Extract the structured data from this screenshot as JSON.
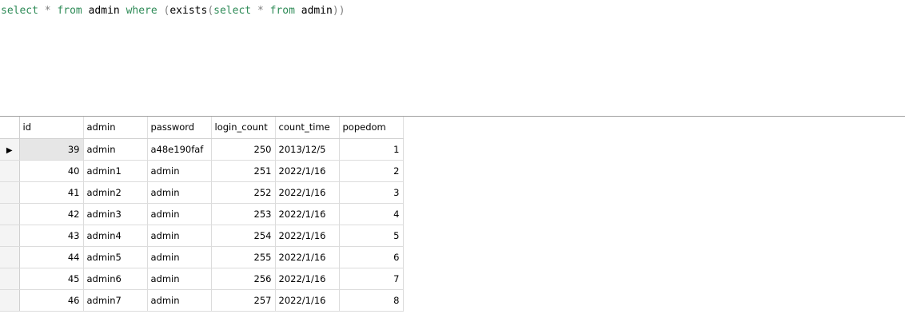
{
  "editor": {
    "tokens": [
      {
        "text": "select",
        "cls": "kw"
      },
      {
        "text": " ",
        "cls": ""
      },
      {
        "text": "*",
        "cls": "op"
      },
      {
        "text": " ",
        "cls": ""
      },
      {
        "text": "from",
        "cls": "kw"
      },
      {
        "text": " admin ",
        "cls": ""
      },
      {
        "text": "where",
        "cls": "kw"
      },
      {
        "text": " ",
        "cls": ""
      },
      {
        "text": "(",
        "cls": "op"
      },
      {
        "text": "exists",
        "cls": ""
      },
      {
        "text": "(",
        "cls": "op"
      },
      {
        "text": "select",
        "cls": "kw"
      },
      {
        "text": " ",
        "cls": ""
      },
      {
        "text": "*",
        "cls": "op"
      },
      {
        "text": " ",
        "cls": ""
      },
      {
        "text": "from",
        "cls": "kw"
      },
      {
        "text": " admin",
        "cls": ""
      },
      {
        "text": "))",
        "cls": "op"
      }
    ]
  },
  "results": {
    "columns": [
      "id",
      "admin",
      "password",
      "login_count",
      "count_time",
      "popedom"
    ],
    "row_pointer_icon": "triangle-right-icon",
    "rows": [
      {
        "id": "39",
        "admin": "admin",
        "password": "a48e190faf",
        "login_count": "250",
        "count_time": "2013/12/5",
        "popedom": "1"
      },
      {
        "id": "40",
        "admin": "admin1",
        "password": "admin",
        "login_count": "251",
        "count_time": "2022/1/16",
        "popedom": "2"
      },
      {
        "id": "41",
        "admin": "admin2",
        "password": "admin",
        "login_count": "252",
        "count_time": "2022/1/16",
        "popedom": "3"
      },
      {
        "id": "42",
        "admin": "admin3",
        "password": "admin",
        "login_count": "253",
        "count_time": "2022/1/16",
        "popedom": "4"
      },
      {
        "id": "43",
        "admin": "admin4",
        "password": "admin",
        "login_count": "254",
        "count_time": "2022/1/16",
        "popedom": "5"
      },
      {
        "id": "44",
        "admin": "admin5",
        "password": "admin",
        "login_count": "255",
        "count_time": "2022/1/16",
        "popedom": "6"
      },
      {
        "id": "45",
        "admin": "admin6",
        "password": "admin",
        "login_count": "256",
        "count_time": "2022/1/16",
        "popedom": "7"
      },
      {
        "id": "46",
        "admin": "admin7",
        "password": "admin",
        "login_count": "257",
        "count_time": "2022/1/16",
        "popedom": "8"
      }
    ]
  },
  "colors": {
    "keyword": "#2e8b57",
    "operator": "#808080",
    "selected_cell": "#e6e6e6",
    "grid_line": "#dcdcdc"
  }
}
